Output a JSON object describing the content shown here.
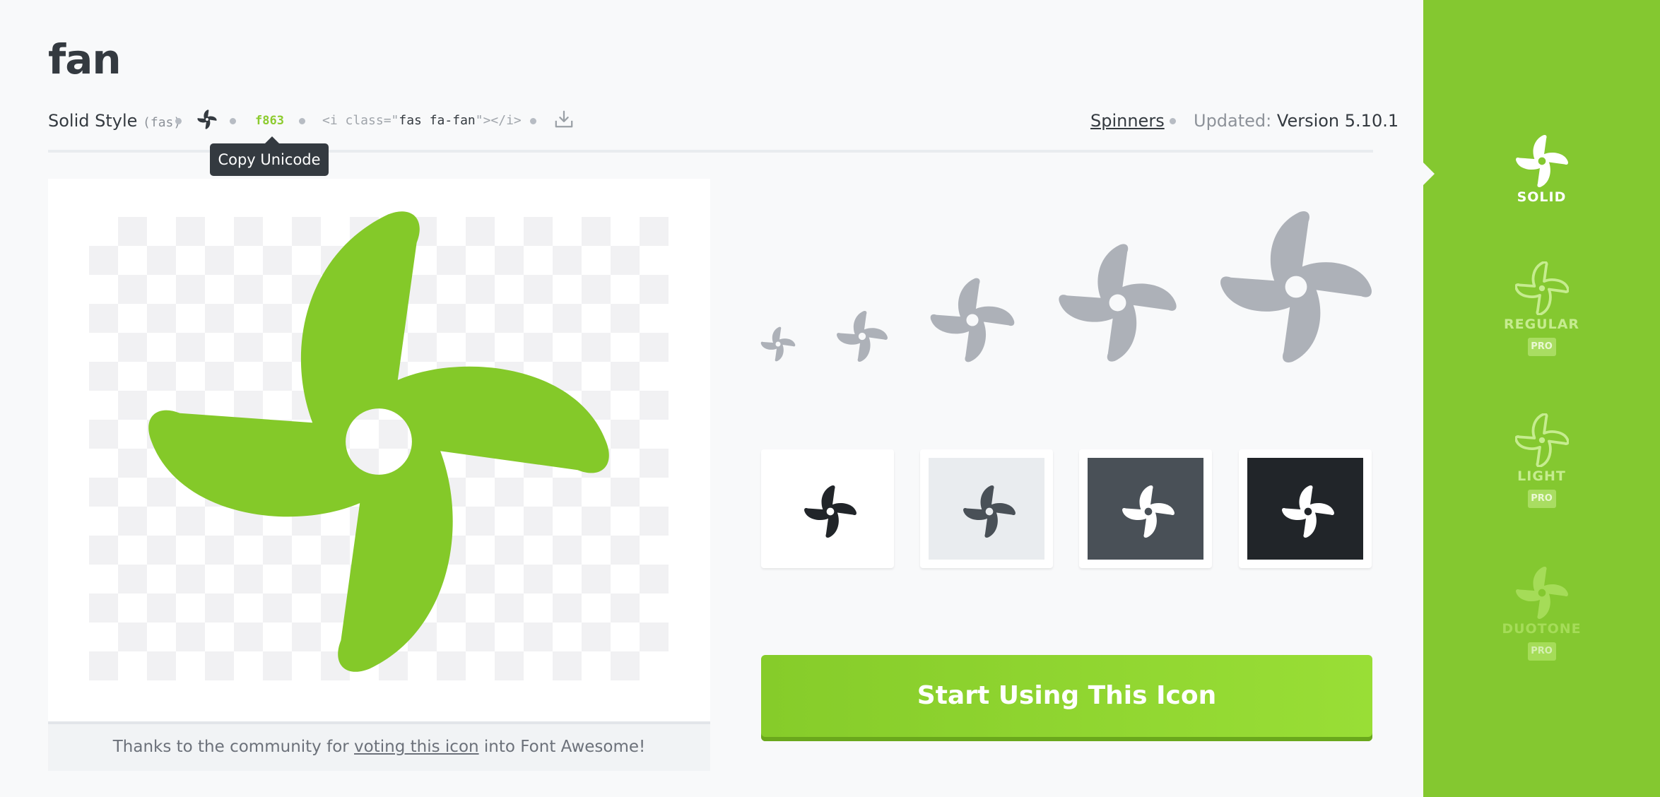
{
  "icon": {
    "name": "fan",
    "unicode": "f863"
  },
  "meta": {
    "style_label": "Solid Style",
    "style_code": "(fas)",
    "html_open": "<i class=\"",
    "html_class": "fas fa-fan",
    "html_close": "\"></i>",
    "category": "Spinners",
    "updated_label": "Updated:",
    "version": "Version 5.10.1"
  },
  "tooltip": "Copy Unicode",
  "community": {
    "before": "Thanks to the community for ",
    "link": "voting this icon",
    "after": " into Font Awesome!"
  },
  "cta_label": "Start Using This Icon",
  "colors": {
    "brand_green": "#84c830",
    "icon_green": "#84c929",
    "size_gray": "#adb1b8",
    "swatch_white": "#ffffff",
    "swatch_light": "#e9ecef",
    "swatch_gray": "#495057",
    "swatch_dark": "#212529"
  },
  "swatches": [
    {
      "bg": "#ffffff",
      "icon": "#212529"
    },
    {
      "bg": "#e9ecef",
      "icon": "#495057"
    },
    {
      "bg": "#495057",
      "icon": "#ffffff"
    },
    {
      "bg": "#212529",
      "icon": "#ffffff"
    }
  ],
  "sidebar": {
    "styles": [
      {
        "label": "SOLID",
        "pro": "",
        "active": true
      },
      {
        "label": "REGULAR",
        "pro": "PRO",
        "active": false
      },
      {
        "label": "LIGHT",
        "pro": "PRO",
        "active": false
      },
      {
        "label": "DUOTONE",
        "pro": "PRO",
        "active": false
      }
    ]
  },
  "icons": {
    "header": "fan-icon",
    "download": "download-icon",
    "preview": "fan-icon",
    "sizes": "fan-icon",
    "swatch": "fan-icon"
  }
}
